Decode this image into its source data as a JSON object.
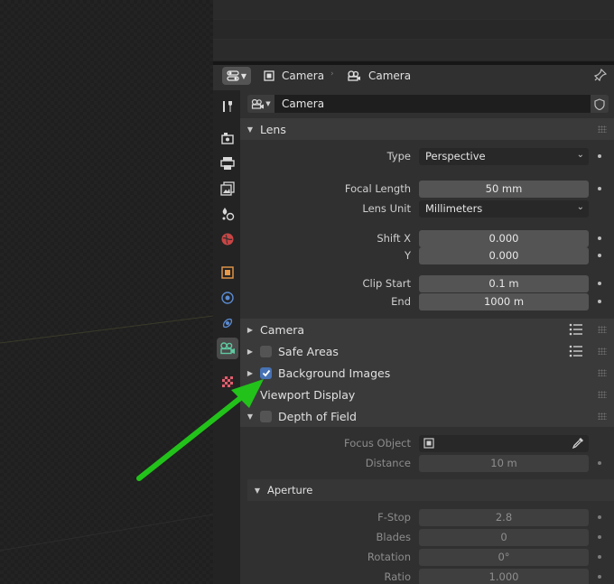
{
  "header": {
    "context_label": "Camera",
    "data_label": "Camera"
  },
  "namebar": {
    "value": "Camera"
  },
  "lens_panel": {
    "title": "Lens",
    "type_label": "Type",
    "type_value": "Perspective",
    "focal_length_label": "Focal Length",
    "focal_length_value": "50 mm",
    "lens_unit_label": "Lens Unit",
    "lens_unit_value": "Millimeters",
    "shift_x_label": "Shift X",
    "shift_x_value": "0.000",
    "shift_y_label": "Y",
    "shift_y_value": "0.000",
    "clip_start_label": "Clip Start",
    "clip_start_value": "0.1 m",
    "clip_end_label": "End",
    "clip_end_value": "1000 m"
  },
  "collapsed_panels": {
    "camera": "Camera",
    "safe_areas": "Safe Areas",
    "background_images": "Background Images",
    "viewport_display": "Viewport Display"
  },
  "dof_panel": {
    "title": "Depth of Field",
    "focus_object_label": "Focus Object",
    "distance_label": "Distance",
    "distance_value": "10 m",
    "aperture_title": "Aperture",
    "fstop_label": "F-Stop",
    "fstop_value": "2.8",
    "blades_label": "Blades",
    "blades_value": "0",
    "rotation_label": "Rotation",
    "rotation_value": "0°",
    "ratio_label": "Ratio",
    "ratio_value": "1.000"
  },
  "checkboxes": {
    "safe_areas": false,
    "background_images": true,
    "depth_of_field": false
  },
  "tabs": [
    "tool",
    "render",
    "output",
    "view-layer",
    "scene",
    "world",
    "object",
    "modifiers",
    "physics",
    "object-data-camera",
    "texture"
  ],
  "colors": {
    "accent_blue": "#4772b3",
    "annotation_arrow": "#22c21a",
    "active_tab_icon": "#5fc9a0"
  }
}
